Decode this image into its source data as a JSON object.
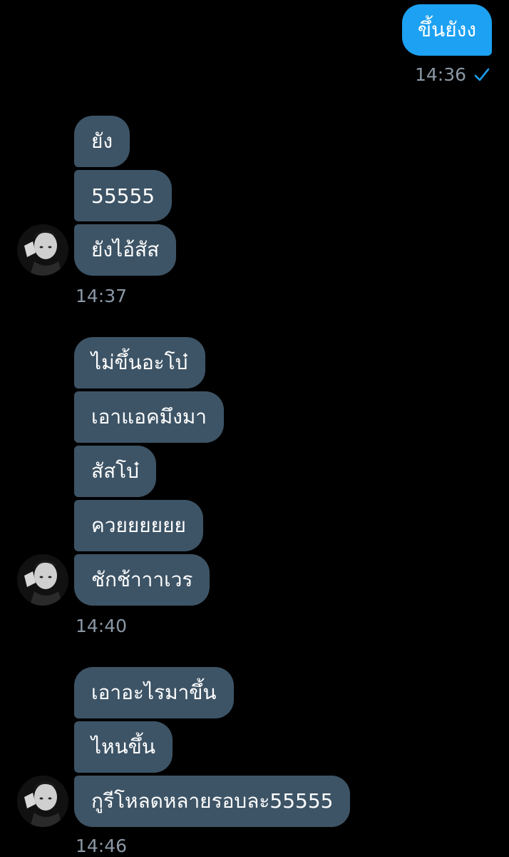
{
  "sent": {
    "text": "ขึ้นยังง",
    "time": "14:36",
    "status_icon": "checkmark-icon"
  },
  "colors": {
    "background": "#000000",
    "sent_bubble": "#1da1f2",
    "received_bubble": "#3d5466",
    "meta_text": "#8b98a5",
    "checkmark": "#1da1f2"
  },
  "groups": [
    {
      "messages": [
        "ยัง",
        "55555",
        "ยังไอ้สัส"
      ],
      "time": "14:37"
    },
    {
      "messages": [
        "ไม่ขึ้นอะโบ๋",
        "เอาแอคมึงมา",
        "สัสโบ๋",
        "ควยยยยยย",
        "ชักช้าาาเวร"
      ],
      "time": "14:40"
    },
    {
      "messages": [
        "เอาอะไรมาขึ้น",
        "ไหนขึ้น",
        "กูรีโหลดหลายรอบละ55555"
      ],
      "time": "14:46"
    }
  ]
}
